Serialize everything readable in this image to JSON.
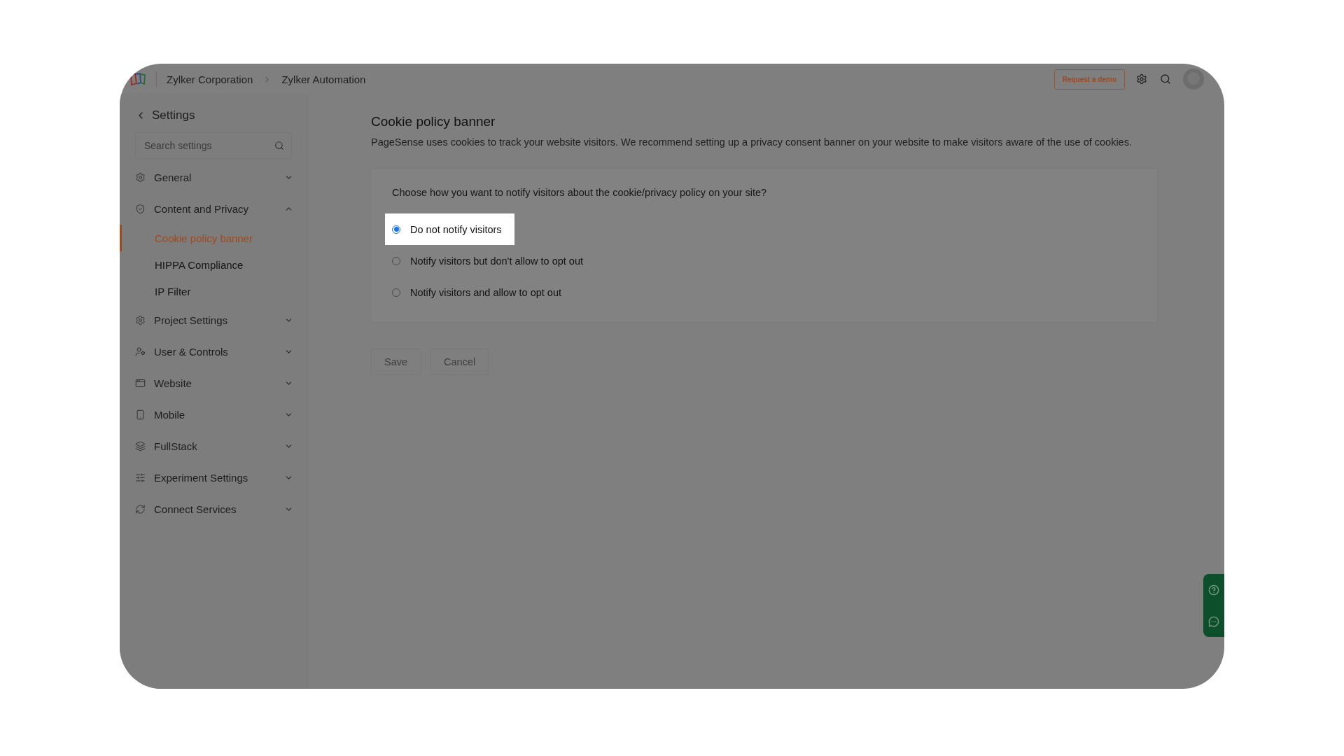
{
  "topbar": {
    "breadcrumbs": [
      "Zylker Corporation",
      "Zylker Automation"
    ],
    "demo_button": "Request a demo"
  },
  "sidebar": {
    "title": "Settings",
    "search": {
      "placeholder": "Search settings"
    },
    "sections": [
      {
        "label": "General",
        "expanded": false
      },
      {
        "label": "Content and Privacy",
        "expanded": true,
        "children": [
          {
            "label": "Cookie policy banner",
            "selected": true
          },
          {
            "label": "HIPPA Compliance",
            "selected": false
          },
          {
            "label": "IP Filter",
            "selected": false
          }
        ]
      },
      {
        "label": "Project Settings",
        "expanded": false
      },
      {
        "label": "User & Controls",
        "expanded": false
      },
      {
        "label": "Website",
        "expanded": false
      },
      {
        "label": "Mobile",
        "expanded": false
      },
      {
        "label": "FullStack",
        "expanded": false
      },
      {
        "label": "Experiment Settings",
        "expanded": false
      },
      {
        "label": "Connect Services",
        "expanded": false
      }
    ]
  },
  "content": {
    "title": "Cookie policy banner",
    "description": "PageSense uses cookies to track your website visitors. We recommend setting up a privacy consent banner on your website to make visitors aware of the use of cookies.",
    "question": "Choose how you want to notify visitors about the cookie/privacy policy on your site?",
    "options": [
      {
        "label": "Do not notify visitors",
        "selected": true,
        "highlighted": true
      },
      {
        "label": "Notify visitors but don't allow to opt out",
        "selected": false,
        "highlighted": false
      },
      {
        "label": "Notify visitors and allow to opt out",
        "selected": false,
        "highlighted": false
      }
    ],
    "buttons": [
      {
        "label": "Save",
        "disabled": true
      },
      {
        "label": "Cancel",
        "disabled": true
      }
    ]
  }
}
